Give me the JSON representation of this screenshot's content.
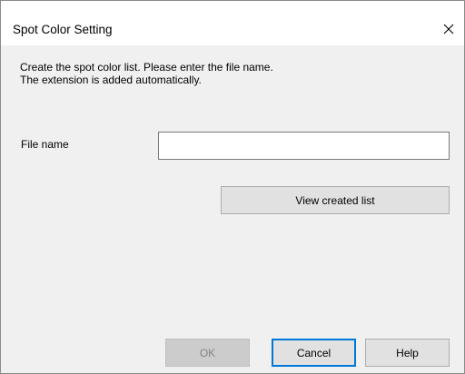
{
  "window": {
    "title": "Spot Color Setting",
    "close_icon": "close-icon"
  },
  "description": {
    "line1": "Create the spot color list. Please enter the file name.",
    "line2": "The extension is added automatically."
  },
  "file_name": {
    "label": "File name",
    "value": ""
  },
  "buttons": {
    "view_created_list": "View created list",
    "ok": "OK",
    "cancel": "Cancel",
    "help": "Help"
  },
  "colors": {
    "focus_border": "#0078d7",
    "disabled_text": "#838383"
  }
}
